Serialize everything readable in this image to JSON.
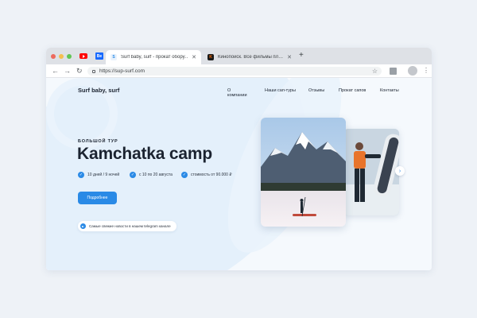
{
  "browser": {
    "tabs": [
      {
        "title": "Surf baby, surf - прокат обору…",
        "favicon": "surf-favicon",
        "active": true
      },
      {
        "title": "Кинопоиск. Все фильмы пл…",
        "favicon": "kinopoisk-favicon",
        "active": false
      }
    ],
    "pinned": [
      {
        "icon": "youtube-icon"
      },
      {
        "icon": "behance-icon",
        "label": "Be"
      }
    ],
    "fav_letters": {
      "surf": "S",
      "kino": "K"
    },
    "url": "https://sup-surf.com",
    "glyphs": {
      "close": "✕",
      "new_tab": "+",
      "back": "←",
      "forward": "→",
      "reload": "↻",
      "star": "☆",
      "menu": "⋮"
    }
  },
  "site": {
    "logo": "Surf baby, surf",
    "nav": [
      "О компании",
      "Наши сап-туры",
      "Отзывы",
      "Прокат сапов",
      "Контакты"
    ],
    "hero": {
      "kicker": "БОЛЬШОЙ ТУР",
      "title": "Kamchatka camp",
      "facts": [
        "10 дней / 9 ночей",
        "с 10 по 20 августа",
        "стоимость от 90.000 ₽"
      ],
      "check_glyph": "✓",
      "cta": "Подробнее",
      "telegram": "Самые свежие новости в нашем telegram канале"
    },
    "gallery": {
      "images": [
        "mountain-lake-paddleboarder-photo",
        "surfer-with-board-photo"
      ],
      "next_glyph": "›"
    }
  },
  "colors": {
    "accent": "#2a8ae6",
    "text": "#1b2330",
    "page_bg": "#f5f9fd",
    "backdrop": "#eef2f7"
  }
}
